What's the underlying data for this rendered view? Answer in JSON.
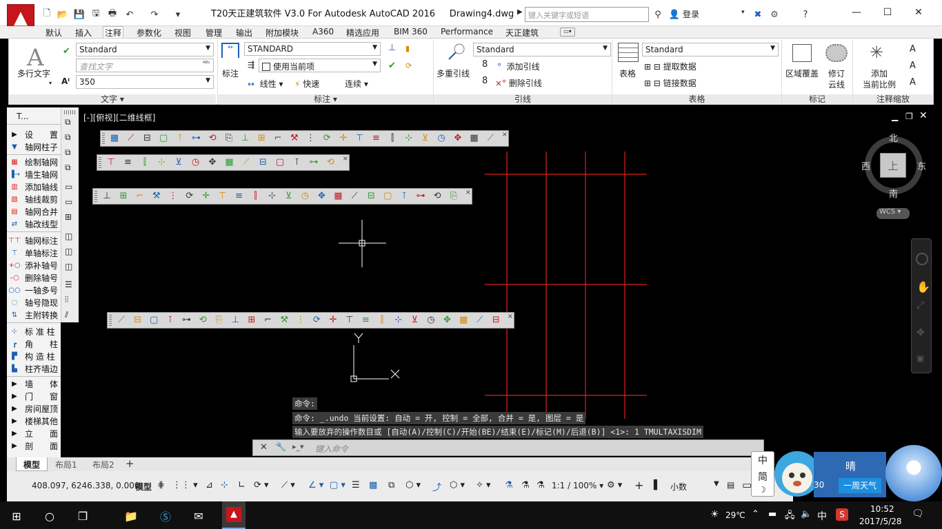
{
  "app": {
    "title": "T20天正建筑软件 V3.0 For Autodesk AutoCAD 2016",
    "document": "Drawing4.dwg",
    "search_placeholder": "键入关键字或短语",
    "login": "登录"
  },
  "ribbon_tabs": [
    "默认",
    "插入",
    "注释",
    "参数化",
    "视图",
    "管理",
    "输出",
    "附加模块",
    "A360",
    "精选应用",
    "BIM 360",
    "Performance",
    "天正建筑"
  ],
  "active_tab": "注释",
  "ribbon": {
    "text_panel": {
      "title": "文字",
      "multiline": "多行文字",
      "style": "Standard",
      "find_placeholder": "查找文字",
      "height": "350"
    },
    "dim_panel": {
      "title": "标注",
      "dim": "标注",
      "style": "STANDARD",
      "layer": "使用当前项",
      "linear": "线性",
      "quick": "快速",
      "continue": "连续"
    },
    "leader_panel": {
      "title": "引线",
      "multileader": "多重引线",
      "style": "Standard",
      "add": "添加引线",
      "remove": "删除引线"
    },
    "table_panel": {
      "title": "表格",
      "table": "表格",
      "style": "Standard",
      "extract": "提取数据",
      "link": "链接数据"
    },
    "markup_panel": {
      "title": "标记",
      "wipeout": "区域覆盖",
      "revcloud_1": "修订",
      "revcloud_2": "云线"
    },
    "scale_panel": {
      "title": "注释缩放",
      "add_scale_1": "添加",
      "add_scale_2": "当前比例"
    }
  },
  "viewport_label": "[-][俯视][二维线框]",
  "left_palette": {
    "header": "T...",
    "groups": [
      {
        "label": "设　　置",
        "collapsed": true
      },
      {
        "label": "轴网柱子",
        "collapsed": false
      }
    ],
    "items_axis": [
      "绘制轴网",
      "墙生轴网",
      "添加轴线",
      "轴线裁剪",
      "轴网合并",
      "轴改线型"
    ],
    "items_label": [
      "轴网标注",
      "单轴标注",
      "添补轴号",
      "删除轴号",
      "一轴多号",
      "轴号隐现",
      "主附转换"
    ],
    "items_column": [
      "标 准 柱",
      "角　　柱",
      "构 造 柱",
      "柱齐墙边"
    ],
    "groups_bottom": [
      "墙　　体",
      "门　　窗",
      "房间屋顶",
      "楼梯其他",
      "立　　面",
      "剖　　面"
    ]
  },
  "viewcube": {
    "n": "北",
    "s": "南",
    "e": "东",
    "w": "西",
    "top": "上",
    "wcs": "WCS"
  },
  "ucs": {
    "x": "X",
    "y": "Y"
  },
  "command": {
    "history": [
      "命令:",
      "命令: _.undo 当前设置: 自动 = 开, 控制 = 全部, 合并 = 是, 图层 = 是",
      "输入要放弃的操作数目或 [自动(A)/控制(C)/开始(BE)/结束(E)/标记(M)/后退(B)] <1>: 1 TMULTAXISDIM"
    ],
    "placeholder": "键入命令"
  },
  "layout_tabs": [
    "模型",
    "布局1",
    "布局2"
  ],
  "status": {
    "coords": "408.097, 6246.338, 0.000",
    "space": "模型",
    "scale": "1:1 / 100%",
    "units": "小数"
  },
  "weather": {
    "ime_1": "中",
    "ime_2": "简",
    "condition": "晴",
    "forecast": "一周天气",
    "temp_partial": "30"
  },
  "taskbar": {
    "temp": "29℃",
    "ime": "中",
    "time": "10:52",
    "date": "2017/5/28"
  },
  "colors": {
    "grid": "#e0211d",
    "accent": "#c4161c",
    "ribbon_bg": "#ffffff",
    "canvas": "#000000"
  }
}
